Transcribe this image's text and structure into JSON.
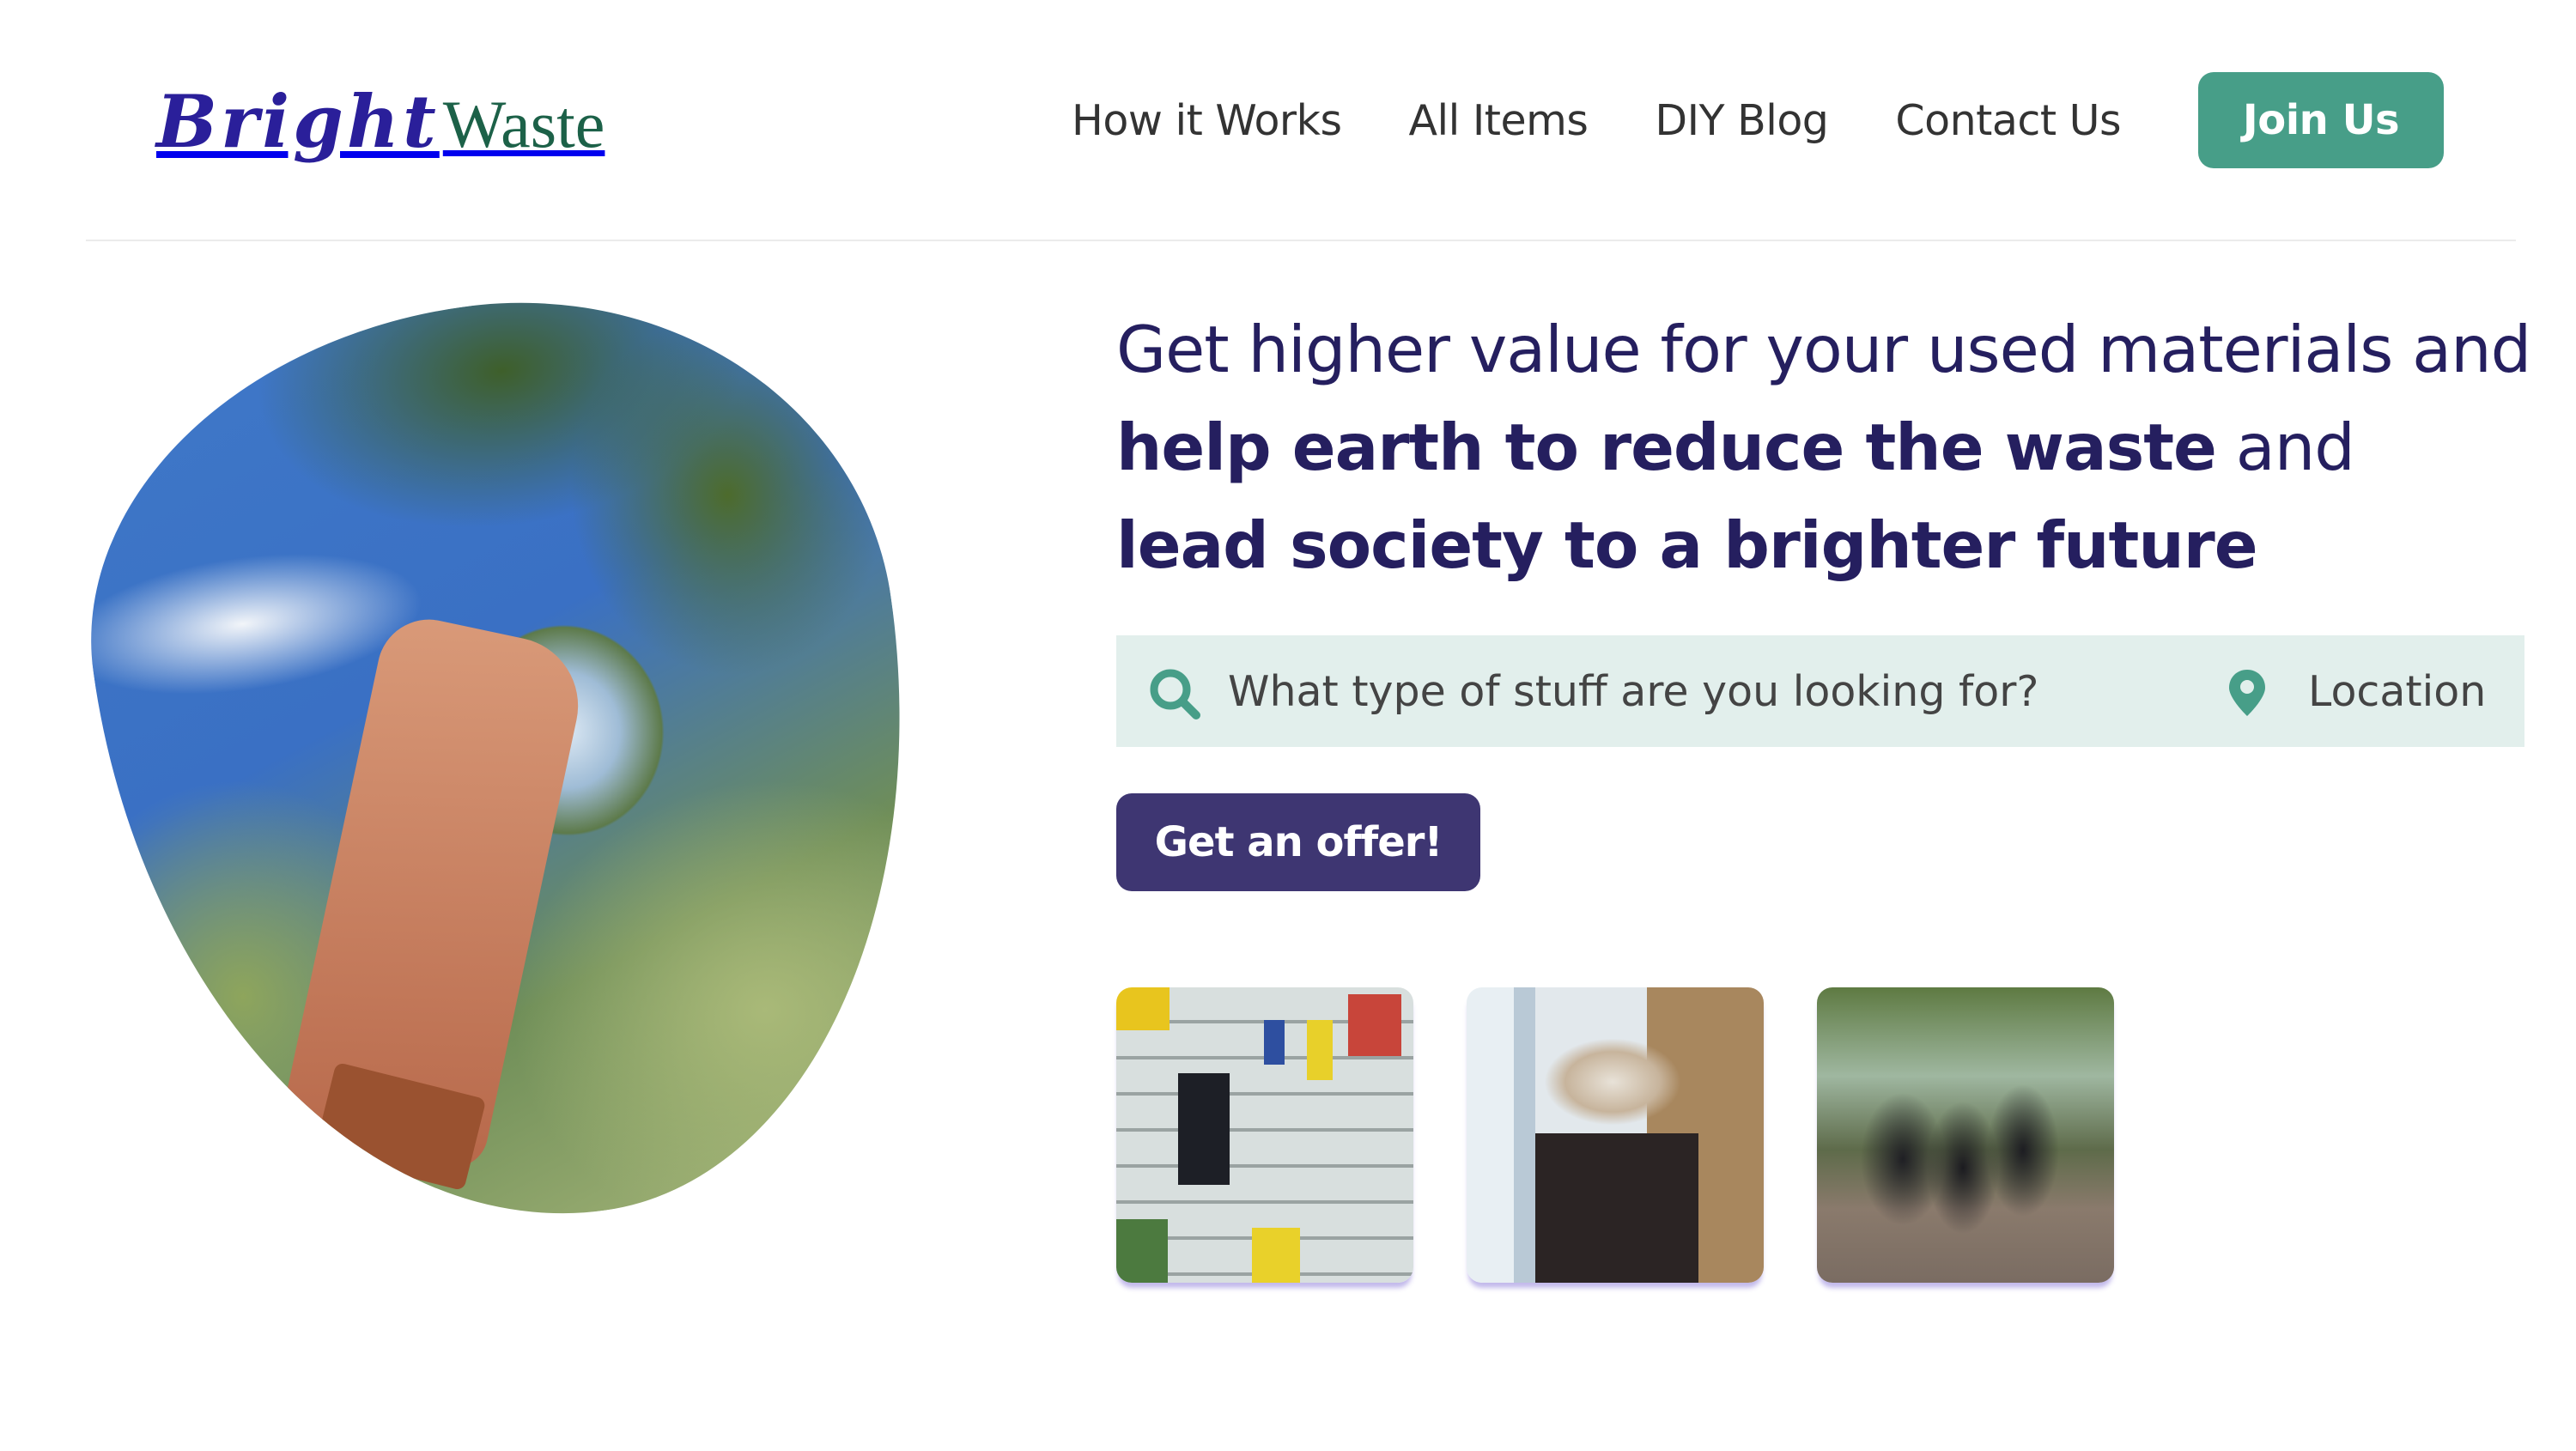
{
  "brand": {
    "name_part1": "Bright",
    "name_part2": "Waste",
    "colors": {
      "part1": "#2a1f9a",
      "part2": "#1c6148"
    }
  },
  "nav": {
    "items": [
      {
        "label": "How it Works"
      },
      {
        "label": "All Items"
      },
      {
        "label": "DIY Blog"
      },
      {
        "label": "Contact Us"
      }
    ],
    "cta_label": "Join Us"
  },
  "hero": {
    "headline": {
      "part1": "Get higher value for your used materials and ",
      "part2_bold": "help earth to reduce the waste",
      "part3": " and ",
      "part4_bold": "lead society to a brighter future"
    },
    "image_alt": "hand holding crystal ball against trees and sky",
    "search": {
      "placeholder": "What type of stuff are you looking for?",
      "value": "",
      "location_placeholder": "Location",
      "location_value": "",
      "search_icon": "search-icon",
      "location_icon": "map-pin-icon"
    },
    "offer_button_label": "Get an offer!",
    "gallery": [
      {
        "alt": "upcycled cans planters on wall"
      },
      {
        "alt": "overflowing waste bin"
      },
      {
        "alt": "group of people celebrating outdoors"
      }
    ]
  },
  "theme": {
    "accent": "#479e88",
    "primary_dark": "#3e3672",
    "headline_color": "#251f5f",
    "search_bg": "#e2efec"
  }
}
